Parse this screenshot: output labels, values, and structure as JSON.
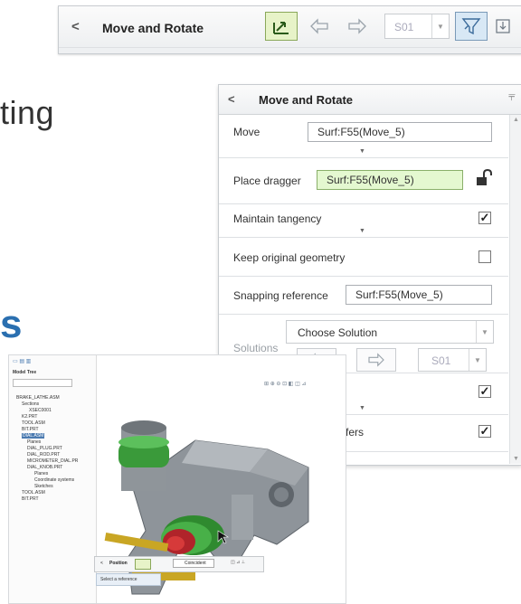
{
  "toolbar": {
    "back": "<",
    "title": "Move and Rotate",
    "solution_value": "S01",
    "icons": [
      "dragger-icon",
      "arrow-left-icon",
      "arrow-right-icon",
      "filter-icon",
      "save-icon"
    ]
  },
  "background_text": {
    "fragment": "ting",
    "letter": "s"
  },
  "panel": {
    "back": "<",
    "title": "Move and Rotate",
    "move_label": "Move",
    "move_value": "Surf:F55(Move_5)",
    "place_dragger_label": "Place dragger",
    "place_dragger_value": "Surf:F55(Move_5)",
    "maintain_tangency_label": "Maintain tangency",
    "maintain_tangency_checked": true,
    "keep_original_label": "Keep original geometry",
    "keep_original_checked": false,
    "snapping_label": "Snapping reference",
    "snapping_value": "Surf:F55(Move_5)",
    "solutions_label": "Solutions",
    "choose_solution": "Choose Solution",
    "solution_value": "S01",
    "row8_checked": true,
    "row9_label_fragment": "fers",
    "row9_checked": true
  },
  "inset": {
    "tree_title": "Model Tree",
    "tree_items": [
      "BRAKE_LATHE.ASM",
      "Sections",
      "XSEC0001",
      "K2.PRT",
      "TOOL.ASM",
      "BIT.PRT",
      "DIAL.ASM",
      "Planes",
      "DIAL_PLUG.PRT",
      "DIAL_ROD.PRT",
      "MICROMETER_DIAL.PR",
      "DIAL_KNOB.PRT",
      "Planes",
      "Coordinate systems",
      "Sketches",
      "TOOL.ASM",
      "BIT.PRT"
    ],
    "toolbar_label": "Position",
    "constraint_label": "Coincident",
    "message": "Select a reference"
  },
  "colors": {
    "accent_blue": "#2a6fb0",
    "green_field": "#e4f8d0"
  }
}
